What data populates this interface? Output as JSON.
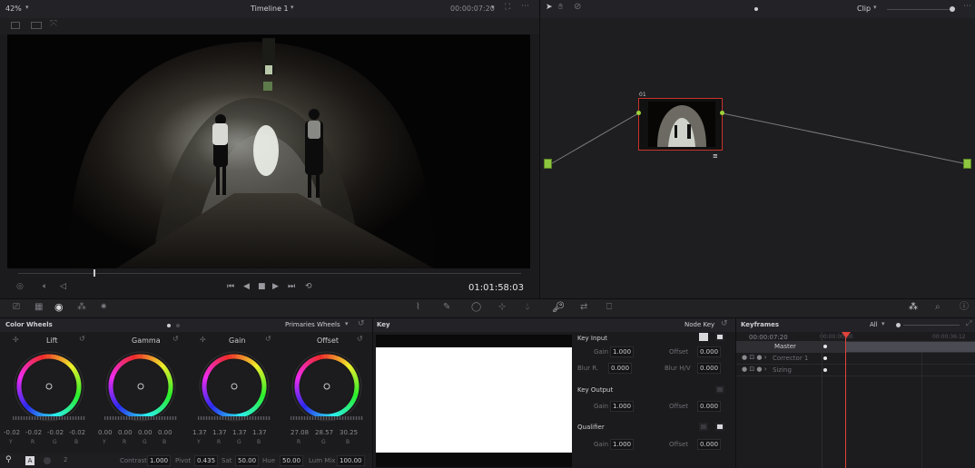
{
  "viewer": {
    "zoom": "42%",
    "timeline_name": "Timeline 1",
    "timecode_top": "00:00:07:20",
    "timecode": "01:01:58:03",
    "playback_icons": [
      "skip-to-start-icon",
      "step-back-icon",
      "stop-icon",
      "play-icon",
      "skip-to-end-icon",
      "loop-icon"
    ]
  },
  "node_editor": {
    "mode": "Clip",
    "node_number": "01",
    "node_flag": "≡"
  },
  "color_wheels": {
    "panel_title": "Color Wheels",
    "mode_label": "Primaries Wheels",
    "wheels": [
      {
        "name": "Lift",
        "values": [
          "-0.02",
          "-0.02",
          "-0.02",
          "-0.02"
        ],
        "channels": [
          "Y",
          "R",
          "G",
          "B"
        ]
      },
      {
        "name": "Gamma",
        "values": [
          "0.00",
          "0.00",
          "0.00",
          "0.00"
        ],
        "channels": [
          "Y",
          "R",
          "G",
          "B"
        ]
      },
      {
        "name": "Gain",
        "values": [
          "1.37",
          "1.37",
          "1.37",
          "1.37"
        ],
        "channels": [
          "Y",
          "R",
          "G",
          "B"
        ]
      },
      {
        "name": "Offset",
        "values": [
          "27.08",
          "28.57",
          "30.25"
        ],
        "channels": [
          "R",
          "G",
          "B"
        ]
      }
    ],
    "bottom": {
      "page": "2",
      "contrast_label": "Contrast",
      "contrast": "1.000",
      "pivot_label": "Pivot",
      "pivot": "0.435",
      "sat_label": "Sat",
      "sat": "50.00",
      "hue_label": "Hue",
      "hue": "50.00",
      "lummix_label": "Lum Mix",
      "lummix": "100.00"
    }
  },
  "key_panel": {
    "title": "Key",
    "node_key_label": "Node Key",
    "key_input": {
      "title": "Key Input",
      "gain_label": "Gain",
      "gain": "1.000",
      "offset_label": "Offset",
      "offset": "0.000",
      "blur_r_label": "Blur R.",
      "blur_r": "0.000",
      "blur_hv_label": "Blur H/V",
      "blur_hv": "0.000"
    },
    "key_output": {
      "title": "Key Output",
      "gain_label": "Gain",
      "gain": "1.000",
      "offset_label": "Offset",
      "offset": "0.000"
    },
    "qualifier": {
      "title": "Qualifier",
      "gain_label": "Gain",
      "gain": "1.000",
      "offset_label": "Offset",
      "offset": "0.000"
    }
  },
  "keyframes": {
    "title": "Keyframes",
    "filter": "All",
    "timecode": "00:00:07:20",
    "ruler_start": "00:00:00:00",
    "ruler_end": "00:00:36:12",
    "tracks": [
      "Master",
      "Corrector 1",
      "Sizing"
    ]
  },
  "colors": {
    "accent_red": "#e0433a",
    "node_border": "#c8342c",
    "connector_green": "#8dc63f",
    "panel_bg": "#1b1b1d",
    "header_bg": "#232327"
  }
}
